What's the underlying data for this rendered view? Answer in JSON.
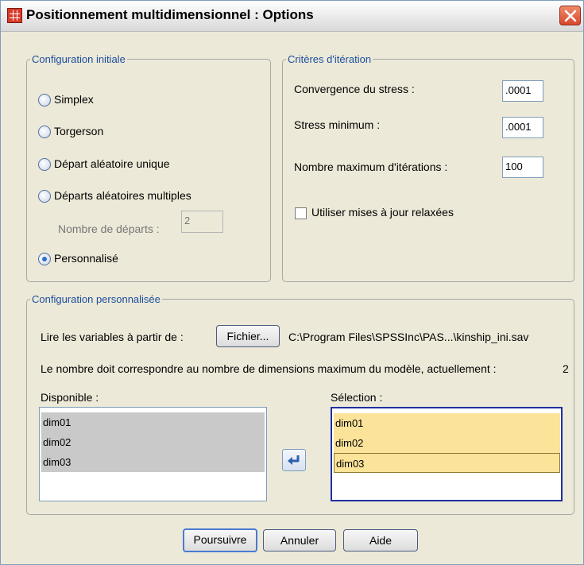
{
  "window": {
    "title": "Positionnement multidimensionnel : Options"
  },
  "initial_config": {
    "legend": "Configuration initiale",
    "options": [
      {
        "label": "Simplex",
        "checked": false
      },
      {
        "label": "Torgerson",
        "checked": false
      },
      {
        "label": "Départ aléatoire unique",
        "checked": false
      },
      {
        "label": "Départs aléatoires multiples",
        "checked": false
      },
      {
        "label": "Personnalisé",
        "checked": true
      }
    ],
    "starts_label": "Nombre de départs :",
    "starts_value": "2"
  },
  "iteration": {
    "legend": "Critères d'itération",
    "convergence_label": "Convergence du stress :",
    "convergence_value": ".0001",
    "min_stress_label": "Stress minimum :",
    "min_stress_value": ".0001",
    "max_iter_label": "Nombre maximum d'itérations :",
    "max_iter_value": "100",
    "relaxed_label": "Utiliser mises à jour relaxées",
    "relaxed_checked": false
  },
  "custom_config": {
    "legend": "Configuration personnalisée",
    "read_label": "Lire les variables à partir de :",
    "file_button": "Fichier...",
    "file_path": "C:\\Program Files\\SPSSInc\\PAS...\\kinship_ini.sav",
    "note": "Le nombre doit correspondre au nombre de dimensions maximum du modèle, actuellement :",
    "dimensions": "2",
    "available_label": "Disponible :",
    "available_items": [
      "dim01",
      "dim02",
      "dim03"
    ],
    "selection_label": "Sélection :",
    "selection_items": [
      "dim01",
      "dim02",
      "dim03"
    ]
  },
  "buttons": {
    "continue": "Poursuivre",
    "cancel": "Annuler",
    "help": "Aide"
  },
  "colors": {
    "dialog_bg": "#ece9d8",
    "legend_blue": "#1a4d9c",
    "selection_yellow": "#fbe39a",
    "available_gray": "#c9c9c9",
    "close_red": "#d9482a"
  }
}
